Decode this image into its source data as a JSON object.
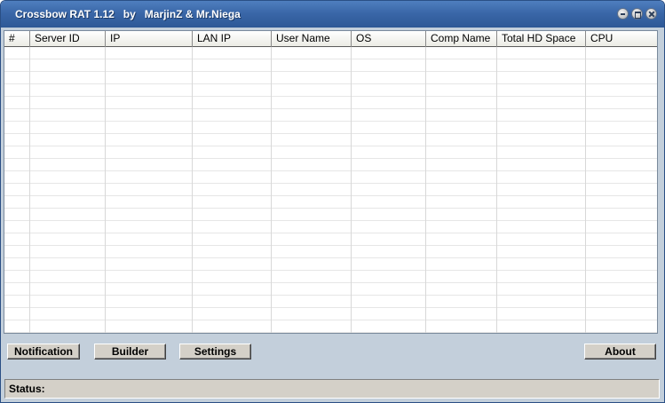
{
  "window": {
    "title": "Crossbow RAT 1.12   by   MarjinZ & Mr.Niega"
  },
  "listview": {
    "columns": [
      "#",
      "Server ID",
      "IP",
      "LAN IP",
      "User Name",
      "OS",
      "Comp Name",
      "Total HD Space",
      "CPU"
    ],
    "rows": []
  },
  "toolbar": {
    "notification_label": "Notification",
    "builder_label": "Builder",
    "settings_label": "Settings",
    "about_label": "About"
  },
  "status": {
    "label": "Status:",
    "value": ""
  },
  "colors": {
    "titlebar": "#3a67a8",
    "window_bg": "#c3cfdb",
    "button_face": "#d4d0c8"
  }
}
